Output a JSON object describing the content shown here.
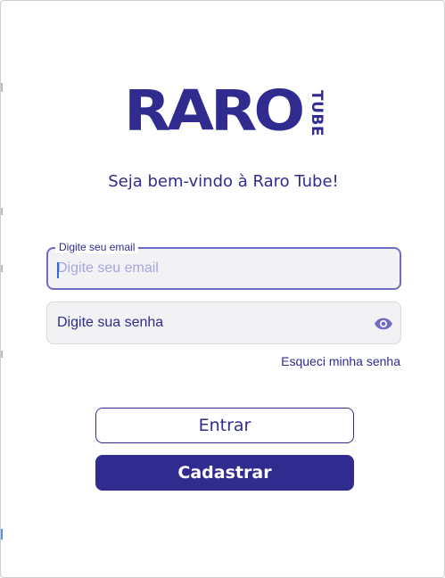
{
  "brand": {
    "logo_word": "RARO",
    "logo_sub": "TUBE",
    "primary_color": "#302c8f",
    "accent_color": "#6f6bc7"
  },
  "welcome_text": "Seja bem-vindo à Raro Tube!",
  "email_field": {
    "label": "Digite seu email",
    "placeholder": "Digite seu email",
    "value": ""
  },
  "password_field": {
    "placeholder": "Digite sua senha",
    "toggle_icon": "eye-icon"
  },
  "forgot_password_link": "Esqueci minha senha",
  "login_button": "Entrar",
  "register_button": "Cadastrar"
}
